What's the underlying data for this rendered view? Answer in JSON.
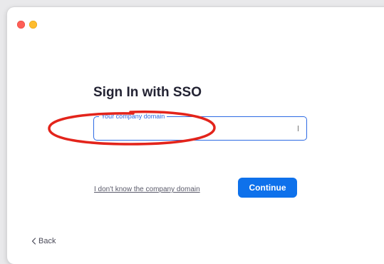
{
  "window": {
    "controls": [
      "close",
      "minimize"
    ]
  },
  "sso": {
    "title": "Sign In with SSO",
    "domain_field_label": "Your company domain",
    "domain_field_value": "",
    "unknown_domain_link": "I don't know the company domain",
    "continue_label": "Continue",
    "back_label": "Back"
  },
  "colors": {
    "accent": "#0e71eb",
    "field_border": "#2d6ae3",
    "annotation": "#e3241b",
    "close": "#fe5f57",
    "minimize": "#febc2e"
  },
  "icons": {
    "back": "chevron-left-icon"
  }
}
